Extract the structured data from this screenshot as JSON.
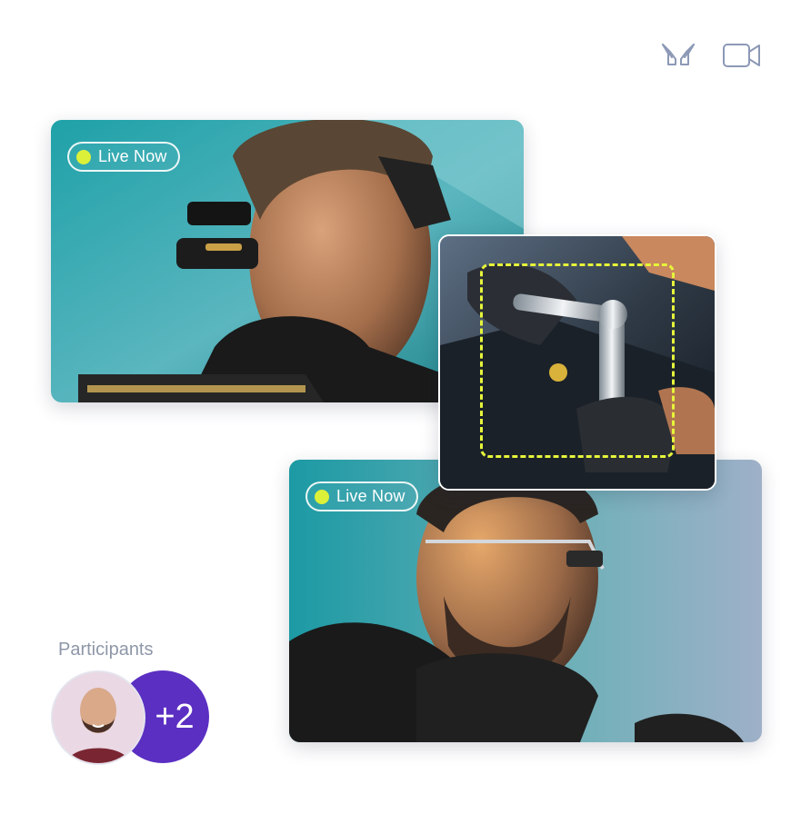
{
  "toolbar": {
    "icons": [
      {
        "name": "hands-icon",
        "label": "Hands"
      },
      {
        "name": "video-camera-icon",
        "label": "Video camera"
      }
    ],
    "icon_color": "#8c99b6"
  },
  "feeds": [
    {
      "live_label": "Live Now",
      "subject": "technician-with-head-mounted-display"
    },
    {
      "subject": "gloved-hands-with-ratchet-wrench-on-engine"
    },
    {
      "live_label": "Live Now",
      "subject": "technician-with-smart-glasses"
    }
  ],
  "live_dot_color": "#dcf03a",
  "focus_box_color": "#e6f53a",
  "participants": {
    "label": "Participants",
    "more_count": "+2",
    "more_color": "#5b2fc2"
  }
}
